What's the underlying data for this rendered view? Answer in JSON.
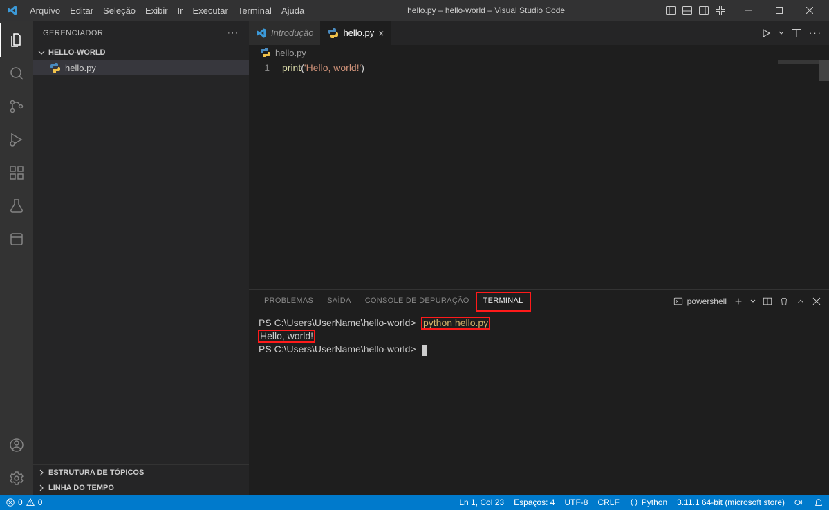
{
  "title": "hello.py – hello-world – Visual Studio Code",
  "menu": [
    "Arquivo",
    "Editar",
    "Seleção",
    "Exibir",
    "Ir",
    "Executar",
    "Terminal",
    "Ajuda"
  ],
  "sidebar": {
    "title": "GERENCIADOR",
    "project": "HELLO-WORLD",
    "files": [
      {
        "name": "hello.py"
      }
    ],
    "sections": [
      "ESTRUTURA DE TÓPICOS",
      "LINHA DO TEMPO"
    ]
  },
  "tabs": [
    {
      "label": "Introdução",
      "active": false,
      "icon": "vscode"
    },
    {
      "label": "hello.py",
      "active": true,
      "icon": "python"
    }
  ],
  "breadcrumb": {
    "file": "hello.py"
  },
  "code": {
    "lines": [
      {
        "num": "1",
        "fn": "print",
        "open": "(",
        "str": "'Hello, world!'",
        "close": ")"
      }
    ]
  },
  "panel": {
    "tabs": [
      "PROBLEMAS",
      "SAÍDA",
      "CONSOLE DE DEPURAÇÃO",
      "TERMINAL"
    ],
    "active": 3,
    "shell": "powershell",
    "terminal": {
      "prompt1": "PS C:\\Users\\UserName\\hello-world>",
      "cmd": "python hello.py",
      "out": "Hello, world!",
      "prompt2": "PS C:\\Users\\UserName\\hello-world>"
    }
  },
  "status": {
    "errors": "0",
    "warnings": "0",
    "pos": "Ln 1, Col 23",
    "spaces": "Espaços: 4",
    "enc": "UTF-8",
    "eol": "CRLF",
    "lang": "Python",
    "py": "3.11.1 64-bit (microsoft store)"
  }
}
